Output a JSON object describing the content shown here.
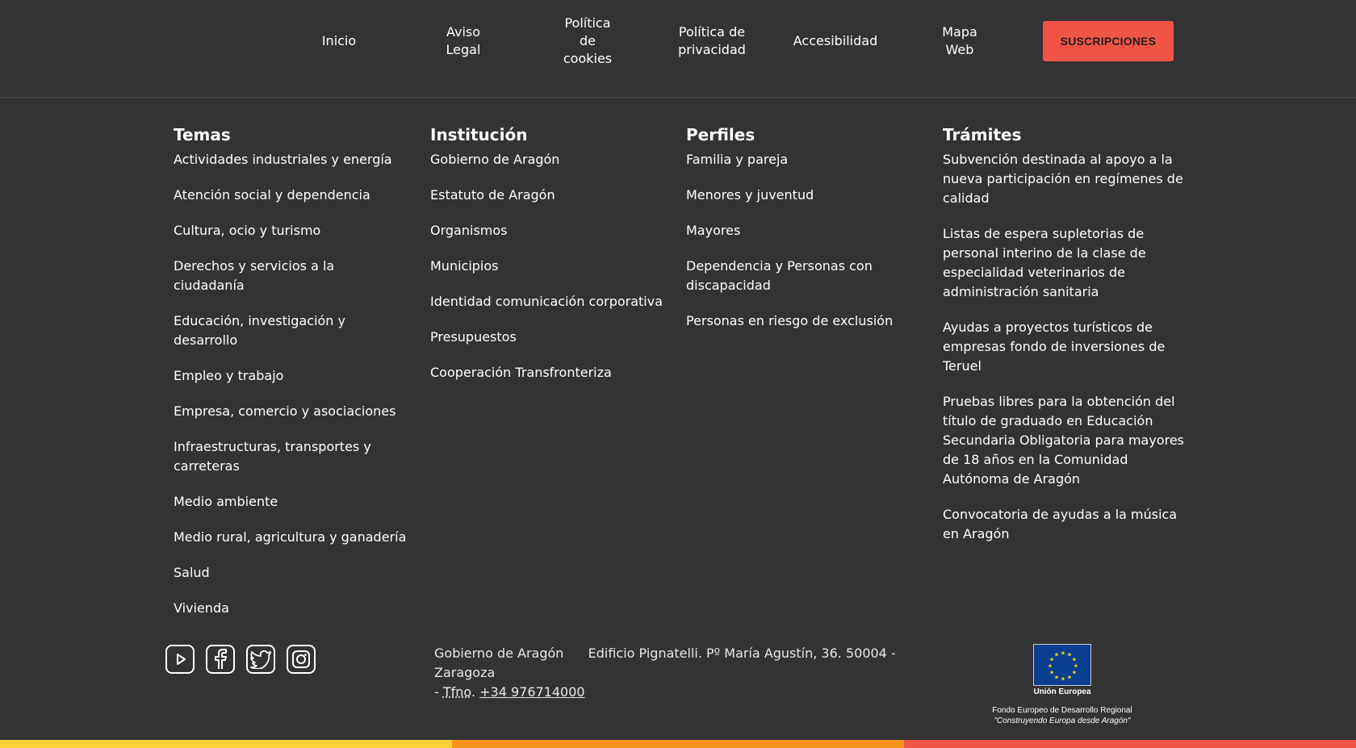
{
  "topnav": {
    "items": [
      {
        "lines": [
          "Inicio"
        ]
      },
      {
        "lines": [
          "Aviso",
          "Legal"
        ]
      },
      {
        "lines": [
          "Política",
          "de",
          "cookies"
        ]
      },
      {
        "lines": [
          "Política de",
          "privacidad"
        ]
      },
      {
        "lines": [
          "Accesibilidad"
        ]
      },
      {
        "lines": [
          "Mapa",
          "Web"
        ]
      }
    ],
    "subscribe_label": "SUSCRIPCIONES"
  },
  "columns": {
    "temas": {
      "title": "Temas",
      "items": [
        "Actividades industriales y energía",
        "Atención social y dependencia",
        "Cultura, ocio y turismo",
        "Derechos y servicios a la ciudadanía",
        "Educación, investigación y desarrollo",
        "Empleo y trabajo",
        "Empresa, comercio y asociaciones",
        "Infraestructuras, transportes y carreteras",
        "Medio ambiente",
        "Medio rural, agricultura y ganadería",
        "Salud",
        "Vivienda"
      ]
    },
    "institucion": {
      "title": "Institución",
      "items": [
        "Gobierno de Aragón",
        "Estatuto de Aragón",
        "Organismos",
        "Municipios",
        "Identidad comunicación corporativa",
        "Presupuestos",
        "Cooperación Transfronteriza"
      ]
    },
    "perfiles": {
      "title": "Perfiles",
      "items": [
        "Familia y pareja",
        "Menores y juventud",
        "Mayores",
        "Dependencia y Personas con discapacidad",
        "Personas en riesgo de exclusión"
      ]
    },
    "tramites": {
      "title": "Trámites",
      "items": [
        "Subvención destinada al apoyo a la nueva participación en regímenes de calidad",
        "Listas de espera supletorias de personal interino de la clase de especialidad veterinarios de administración sanitaria",
        "Ayudas a proyectos turísticos de empresas fondo de inversiones de Teruel",
        "Pruebas libres para la obtención del título de graduado en Educación Secundaria Obligatoria para mayores de 18 años en la Comunidad Autónoma de Aragón",
        "Convocatoria de ayudas a la música en Aragón"
      ]
    }
  },
  "social": {
    "icons": [
      "youtube-icon",
      "facebook-icon",
      "twitter-icon",
      "instagram-icon"
    ]
  },
  "address": {
    "org": "Gobierno de Aragón",
    "building": "Edificio Pignatelli. Pº María Agustín, 36. 50004 - Zaragoza",
    "dash": "-",
    "phone_abbr": "Tfno",
    "phone_sep": ".",
    "phone_number": "+34 976714000"
  },
  "eu": {
    "caption": "Unión Europea",
    "fund": "Fondo Europeo de Desarrollo Regional",
    "motto": "\"Construyendo Europa desde Aragón\""
  },
  "colors": {
    "background": "#333333",
    "accent": "#f05446",
    "stripe_yellow": "#fcd03a",
    "stripe_orange": "#f7941d",
    "stripe_red": "#f05446",
    "eu_blue": "#0b3d91",
    "eu_star": "#ffdd00"
  }
}
